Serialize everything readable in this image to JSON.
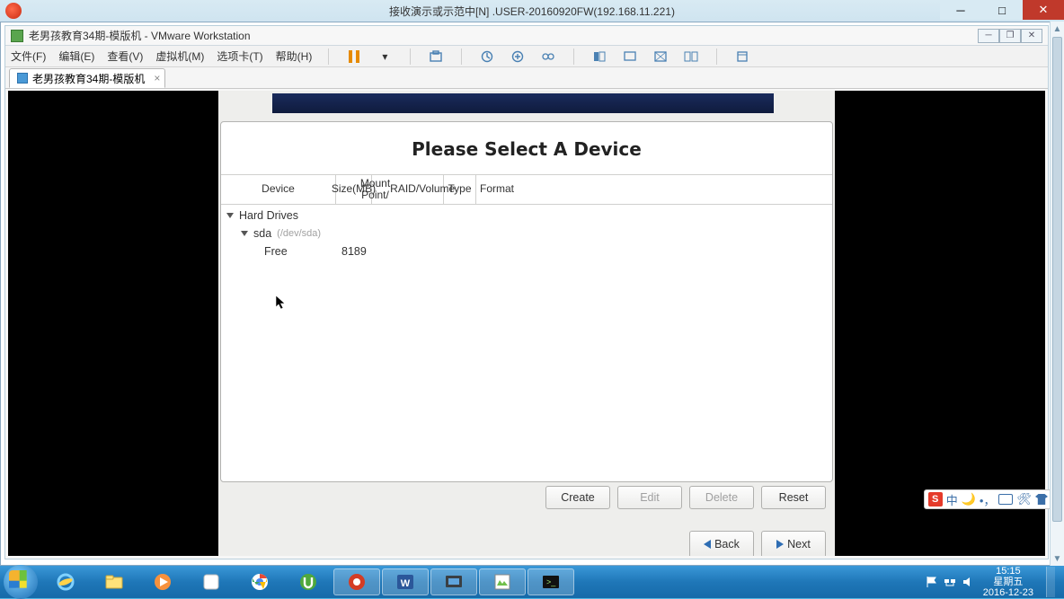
{
  "outer": {
    "title": "接收演示或示范中[N] .USER-20160920FW(192.168.11.221)"
  },
  "vmware": {
    "title": "老男孩教育34期-模版机 - VMware Workstation",
    "menu": {
      "file": "文件(F)",
      "edit": "编辑(E)",
      "view": "查看(V)",
      "vm": "虚拟机(M)",
      "tabs": "选项卡(T)",
      "help": "帮助(H)"
    },
    "tab": {
      "label": "老男孩教育34期-模版机"
    }
  },
  "guest": {
    "heading": "Please Select A Device",
    "columns": {
      "device": "Device",
      "size_line1": "Size",
      "size_line2": "(MB)",
      "mount_line1": "Mount Point/",
      "mount_line2": "RAID/Volume",
      "type": "Type",
      "format": "Format"
    },
    "tree": {
      "hard_drives": "Hard Drives",
      "sda": "sda",
      "sda_path": "(/dev/sda)",
      "free_label": "Free",
      "free_size": "8189"
    },
    "actions": {
      "create": "Create",
      "edit": "Edit",
      "delete": "Delete",
      "reset": "Reset"
    },
    "nav": {
      "back": "Back",
      "next": "Next"
    }
  },
  "ime": {
    "badge": "S",
    "lang": "中"
  },
  "clock": {
    "time": "15:15",
    "weekday": "星期五",
    "date": "2016-12-23"
  }
}
